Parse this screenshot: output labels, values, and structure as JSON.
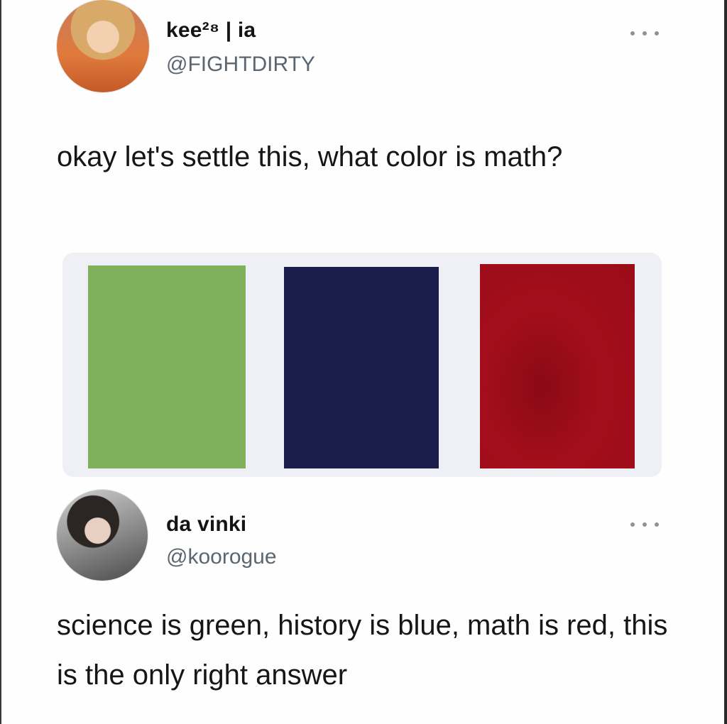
{
  "tweets": [
    {
      "display_name": "kee²⁸ | ia",
      "handle": "@FIGHTDIRTY",
      "text": "okay let's settle this, what color is math?",
      "media": {
        "swatches": [
          {
            "name": "green",
            "color": "#7fb05c"
          },
          {
            "name": "navy",
            "color": "#1a1d4a"
          },
          {
            "name": "red",
            "color": "#9b0c18"
          }
        ]
      }
    },
    {
      "display_name": "da vinki",
      "handle": "@koorogue",
      "text": "science is green, history is blue, math is red, this is the only right answer"
    }
  ],
  "icons": {
    "more": "more-horizontal-icon"
  }
}
